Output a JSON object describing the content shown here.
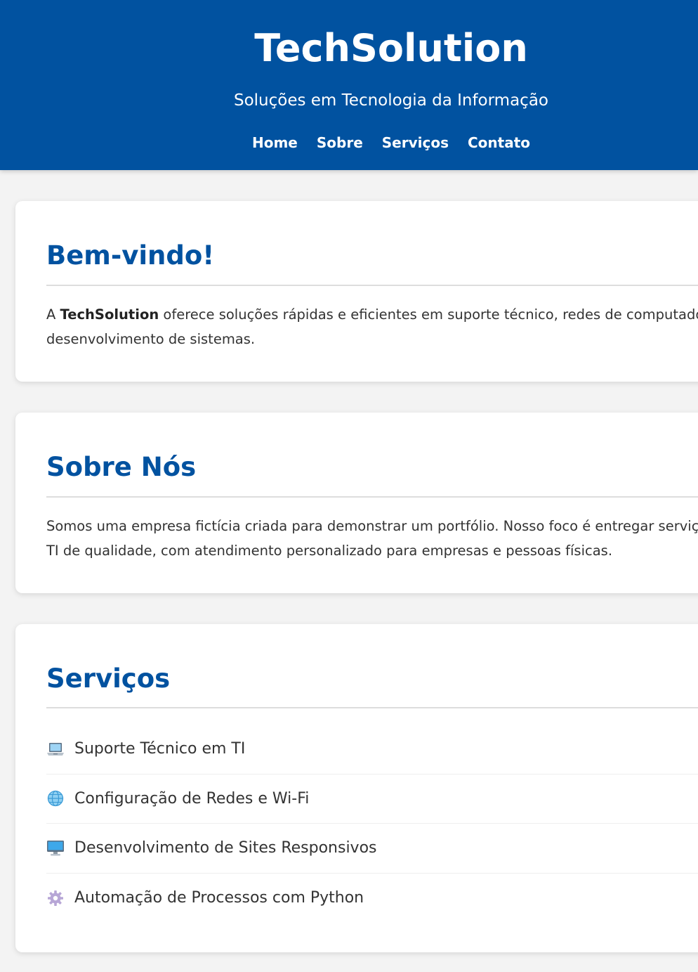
{
  "header": {
    "brand": "TechSolution",
    "tagline": "Soluções em Tecnologia da Informação",
    "nav": [
      {
        "label": "Home"
      },
      {
        "label": "Sobre"
      },
      {
        "label": "Serviços"
      },
      {
        "label": "Contato"
      }
    ]
  },
  "welcome": {
    "title": "Bem-vindo!",
    "text_prefix": "A ",
    "brand": "TechSolution",
    "text_line1": " oferece soluções rápidas e eficientes em suporte técnico, redes de computadore",
    "text_line2": "desenvolvimento de sistemas."
  },
  "about": {
    "title": "Sobre Nós",
    "text_line1": "Somos uma empresa fictícia criada para demonstrar um portfólio. Nosso foco é entregar serviço",
    "text_line2": "TI de qualidade, com atendimento personalizado para empresas e pessoas físicas."
  },
  "services": {
    "title": "Serviços",
    "items": [
      {
        "icon": "laptop-icon",
        "label": "Suporte Técnico em TI"
      },
      {
        "icon": "globe-icon",
        "label": "Configuração de Redes e Wi-Fi"
      },
      {
        "icon": "desktop-computer-icon",
        "label": "Desenvolvimento de Sites Responsivos"
      },
      {
        "icon": "gear-icon",
        "label": "Automação de Processos com Python"
      }
    ]
  },
  "colors": {
    "primary": "#0152a0",
    "background": "#f3f3f3",
    "card": "#ffffff",
    "text": "#333333"
  }
}
